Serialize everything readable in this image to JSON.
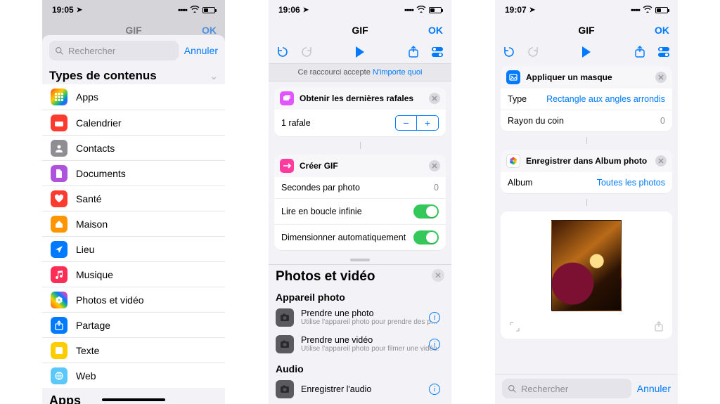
{
  "colors": {
    "accent": "#007aff",
    "green": "#34c759"
  },
  "s1": {
    "time": "19:05",
    "behind_title": "GIF",
    "behind_ok": "OK",
    "search_placeholder": "Rechercher",
    "cancel": "Annuler",
    "section": "Types de contenus",
    "items": [
      {
        "label": "Apps",
        "bg": "linear-gradient(135deg,#ff3b30,#ff9500,#ffcc00,#34c759,#007aff,#af52de)",
        "glyph": "grid"
      },
      {
        "label": "Calendrier",
        "bg": "#ff3b30",
        "glyph": "cal"
      },
      {
        "label": "Contacts",
        "bg": "#8e8e93",
        "glyph": "person"
      },
      {
        "label": "Documents",
        "bg": "#af52de",
        "glyph": "doc"
      },
      {
        "label": "Santé",
        "bg": "#ff3b30",
        "glyph": "heart"
      },
      {
        "label": "Maison",
        "bg": "#ff9500",
        "glyph": "home"
      },
      {
        "label": "Lieu",
        "bg": "#007aff",
        "glyph": "loc"
      },
      {
        "label": "Musique",
        "bg": "#ff2d55",
        "glyph": "music"
      },
      {
        "label": "Photos et vidéo",
        "bg": "linear-gradient(45deg,#ff3b30,#ff9500,#ffcc00,#34c759,#007aff,#af52de,#ff2d55)",
        "glyph": "flower"
      },
      {
        "label": "Partage",
        "bg": "#007aff",
        "glyph": "share"
      },
      {
        "label": "Texte",
        "bg": "#ffcc00",
        "glyph": "text"
      },
      {
        "label": "Web",
        "bg": "#5ac8fa",
        "glyph": "globe"
      }
    ],
    "peek": "Apps"
  },
  "s2": {
    "time": "19:06",
    "title": "GIF",
    "ok": "OK",
    "accept_pre": "Ce raccourci accepte ",
    "accept_link": "N'importe quoi",
    "action1": {
      "title": "Obtenir les dernières rafales",
      "count_label": "1 rafale",
      "bg": "#e055ff"
    },
    "action2": {
      "title": "Créer GIF",
      "bg": "#ff3b9e",
      "rows": [
        {
          "label": "Secondes par photo",
          "value": "0",
          "type": "value"
        },
        {
          "label": "Lire en boucle infinie",
          "type": "toggle",
          "on": true
        },
        {
          "label": "Dimensionner automatiquement",
          "type": "toggle",
          "on": true
        }
      ]
    },
    "drawer": {
      "title": "Photos et vidéo",
      "group1": "Appareil photo",
      "acts1": [
        {
          "title": "Prendre une photo",
          "sub": "Utilise l'appareil photo pour prendre des p…"
        },
        {
          "title": "Prendre une vidéo",
          "sub": "Utilise l'appareil photo pour filmer une vidéo."
        }
      ],
      "group2": "Audio",
      "acts2": [
        {
          "title": "Enregistrer l'audio",
          "sub": ""
        }
      ]
    }
  },
  "s3": {
    "time": "19:07",
    "title": "GIF",
    "ok": "OK",
    "mask": {
      "title": "Appliquer un masque",
      "bg": "#007aff",
      "rows": [
        {
          "label": "Type",
          "value": "Rectangle aux angles arrondis",
          "link": true
        },
        {
          "label": "Rayon du coin",
          "value": "0",
          "link": false
        }
      ]
    },
    "save": {
      "title": "Enregistrer dans Album photo",
      "rows": [
        {
          "label": "Album",
          "value": "Toutes les photos",
          "link": true
        }
      ]
    },
    "search_placeholder": "Rechercher",
    "cancel": "Annuler"
  }
}
